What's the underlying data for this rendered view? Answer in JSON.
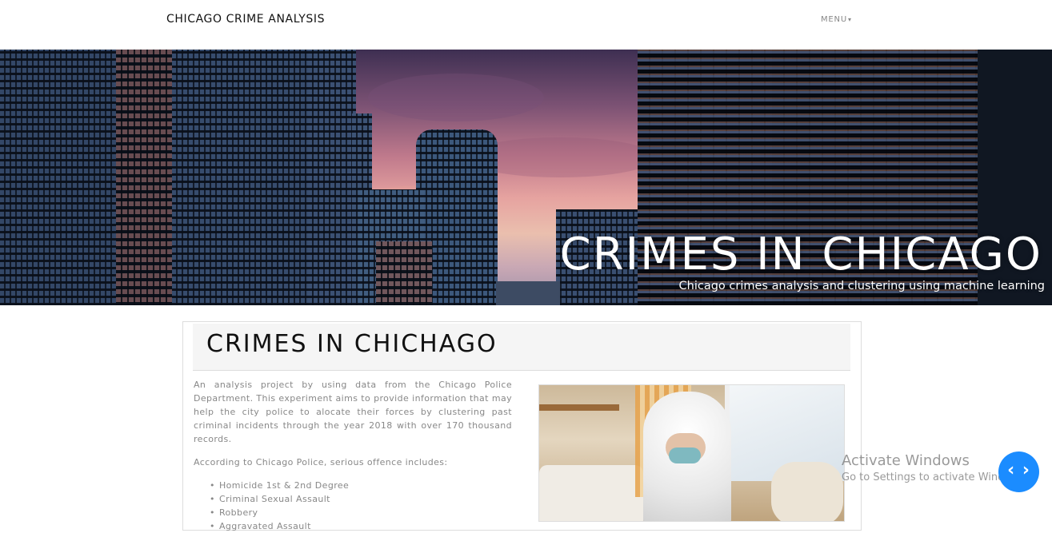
{
  "navbar": {
    "brand": "CHICAGO CRIME ANALYSIS",
    "menu_label": "MENU",
    "menu_caret": "▾"
  },
  "hero": {
    "title": "CRIMES IN CHICAGO",
    "subtitle": "Chicago crimes analysis and clustering using machine learning"
  },
  "content": {
    "heading": "CRIMES IN CHICHAGO",
    "intro": "An analysis project by using data from the Chicago Police Department. This experiment aims to provide information that may help the city police to alocate their forces by clustering past criminal incidents through the year 2018 with over 170 thousand records.",
    "offence_intro": "According to Chicago Police, serious offence includes:",
    "offences": [
      "Homicide 1st & 2nd Degree",
      "Criminal Sexual Assault",
      "Robbery",
      "Aggravated Assault"
    ]
  },
  "overlay": {
    "activate_title": "Activate Windows",
    "activate_sub": "Go to Settings to activate Windows.",
    "nav_button": "‹ ›"
  },
  "colors": {
    "accent_button": "#1b8cff",
    "heading_bg": "#f5f5f5"
  }
}
